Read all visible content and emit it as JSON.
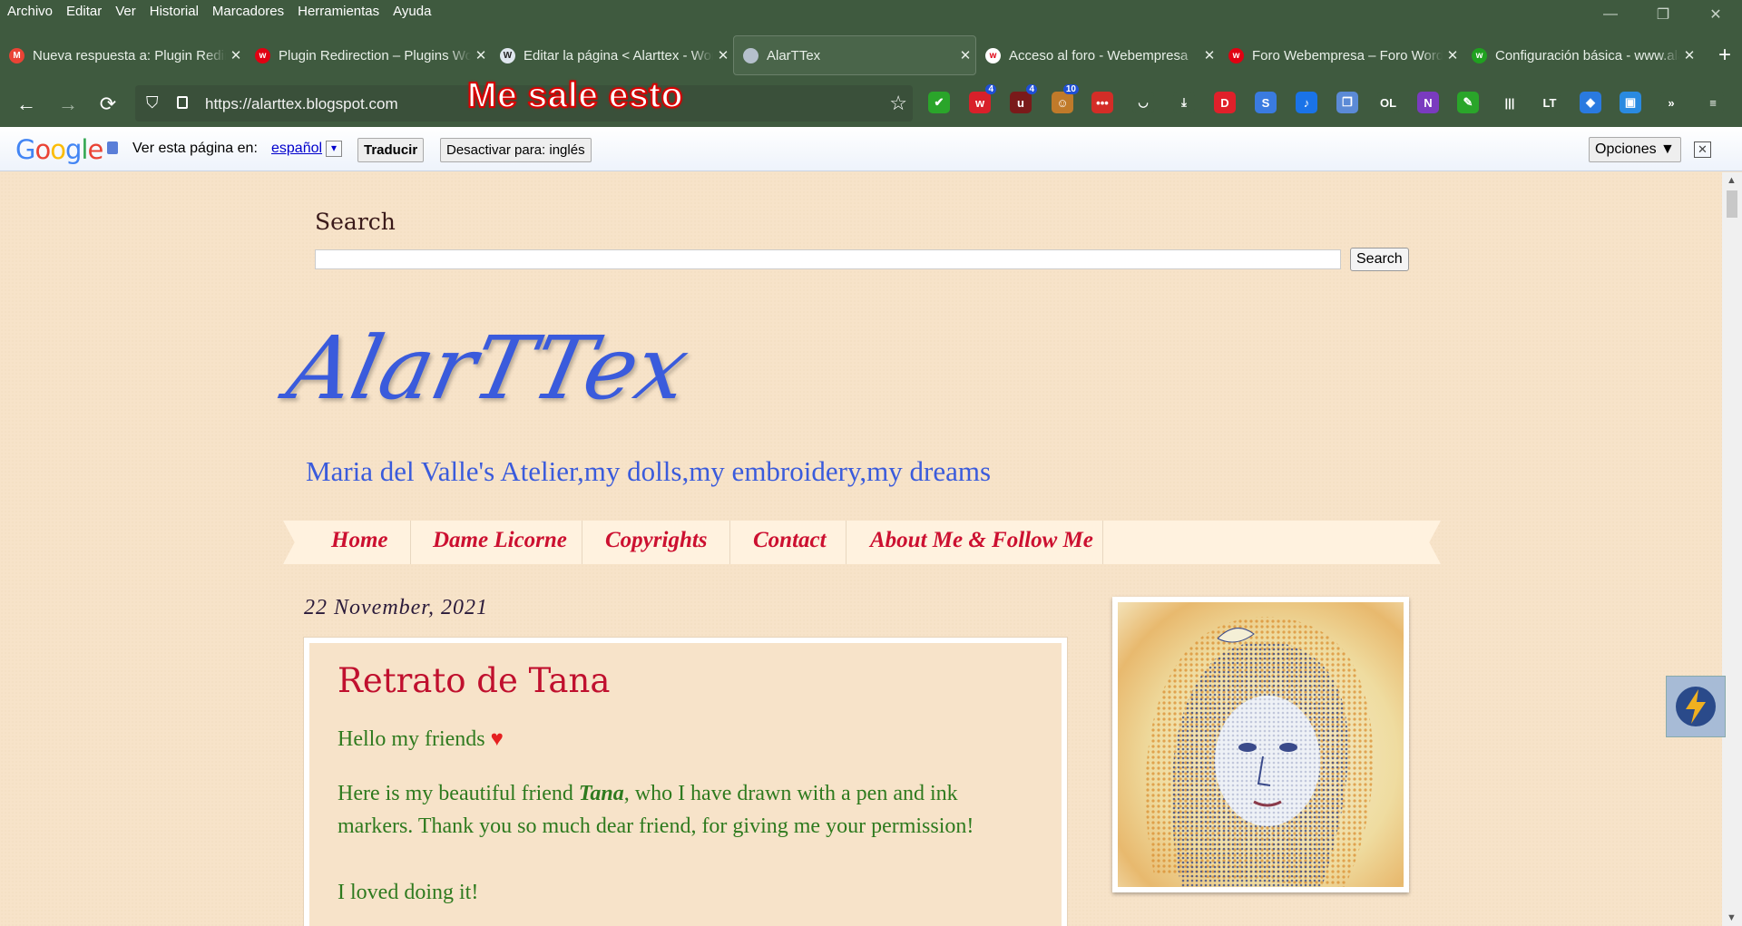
{
  "menu": [
    "Archivo",
    "Editar",
    "Ver",
    "Historial",
    "Marcadores",
    "Herramientas",
    "Ayuda"
  ],
  "window_controls": [
    "—",
    "❐",
    "✕"
  ],
  "tabs": [
    {
      "title": "Nueva respuesta a: Plugin Redirection",
      "favicon": "M",
      "fav_color": "#ea4335",
      "active": false
    },
    {
      "title": "Plugin Redirection – Plugins WordPress",
      "favicon": "w",
      "fav_color": "#e00012",
      "active": false
    },
    {
      "title": "Editar la página < Alarttex - WordPress",
      "favicon": "W",
      "fav_color": "#dfe6ee",
      "active": false
    },
    {
      "title": "AlarTTex",
      "favicon": "",
      "fav_color": "#b5c0cc",
      "active": true
    },
    {
      "title": "Acceso al foro - Webempresa",
      "favicon": "w",
      "fav_color": "#ffffff",
      "active": false
    },
    {
      "title": "Foro Webempresa – Foro WordPress",
      "favicon": "w",
      "fav_color": "#e00012",
      "active": false
    },
    {
      "title": "Configuración básica - www.alarttex.com",
      "favicon": "w",
      "fav_color": "#20a020",
      "active": false
    }
  ],
  "newtab_icon": "+",
  "close_glyph": "✕",
  "nav": {
    "back": "←",
    "forward": "→",
    "reload": "⟳",
    "url": "https://alarttex.blogspot.com",
    "bookmark_icon": "☆"
  },
  "annotation": "Me sale esto",
  "extensions": [
    {
      "name": "check-extension-icon",
      "glyph": "✔",
      "color": "#2aa52a",
      "badge": ""
    },
    {
      "name": "extension-badge-4a-icon",
      "glyph": "w",
      "color": "#d8202a",
      "badge": "4"
    },
    {
      "name": "extension-badge-4b-icon",
      "glyph": "u",
      "color": "#7a1a1a",
      "badge": "4"
    },
    {
      "name": "extension-badge-10-icon",
      "glyph": "☺",
      "color": "#c07a2a",
      "badge": "10"
    },
    {
      "name": "lastpass-icon",
      "glyph": "•••",
      "color": "#d32d27",
      "badge": ""
    },
    {
      "name": "pocket-icon",
      "glyph": "◡",
      "color": "#3f5a3f",
      "badge": ""
    },
    {
      "name": "download-icon",
      "glyph": "⤓",
      "color": "#3f5a3f",
      "badge": ""
    },
    {
      "name": "d-extension-icon",
      "glyph": "D",
      "color": "#e0202a",
      "badge": ""
    },
    {
      "name": "s-extension-icon",
      "glyph": "S",
      "color": "#3a7be0",
      "badge": ""
    },
    {
      "name": "tiktok-icon",
      "glyph": "♪",
      "color": "#1a73e8",
      "badge": ""
    },
    {
      "name": "copy-icon",
      "glyph": "❐",
      "color": "#5b8ad6",
      "badge": ""
    },
    {
      "name": "ol-extension-icon",
      "glyph": "OL",
      "color": "#3f5a3f",
      "badge": ""
    },
    {
      "name": "onenote-icon",
      "glyph": "N",
      "color": "#7a3bbf",
      "badge": ""
    },
    {
      "name": "evernote-icon",
      "glyph": "✎",
      "color": "#2aa52a",
      "badge": ""
    },
    {
      "name": "library-icon",
      "glyph": "|||",
      "color": "#3f5a3f",
      "badge": ""
    },
    {
      "name": "lt-extension-icon",
      "glyph": "LT",
      "color": "#3f5a3f",
      "badge": ""
    },
    {
      "name": "pin-extension-icon",
      "glyph": "◆",
      "color": "#2a7ae0",
      "badge": ""
    },
    {
      "name": "save-icon",
      "glyph": "▣",
      "color": "#2a8ae0",
      "badge": ""
    },
    {
      "name": "overflow-icon",
      "glyph": "»",
      "color": "#3f5a3f",
      "badge": ""
    },
    {
      "name": "hamburger-menu-icon",
      "glyph": "≡",
      "color": "#3f5a3f",
      "badge": ""
    }
  ],
  "translate": {
    "logo": "Google",
    "label": "Ver esta página en:",
    "language": "español",
    "dropdown": "▾",
    "translate_btn": "Traducir",
    "disable_btn": "Desactivar para: inglés",
    "options_btn": "Opciones ▼",
    "close": "✕"
  },
  "page": {
    "search_title": "Search",
    "search_btn": "Search",
    "blog_title": "AlarTTex",
    "blog_desc": "Maria del Valle's Atelier,my dolls,my embroidery,my dreams",
    "nav_items": [
      "Home",
      "Dame Licorne",
      "Copyrights",
      "Contact",
      "About Me & Follow Me"
    ],
    "post_date": "22 November, 2021",
    "post_title": "Retrato de Tana",
    "p1": "Hello my friends",
    "heart": "♥",
    "p2_a": "Here is my beautiful friend ",
    "p2_b": "Tana",
    "p2_c": ", who I have drawn with a pen and ink",
    "p2_d": "markers. Thank you so much dear friend, for giving me your permission!",
    "p3": "I loved doing it!"
  },
  "colors": {
    "chrome": "#3f5a3f",
    "page_bg": "#f7e3c9",
    "title_blue": "#3a5bdc",
    "nav_red": "#cc1030",
    "text_green": "#2e7a1e"
  }
}
